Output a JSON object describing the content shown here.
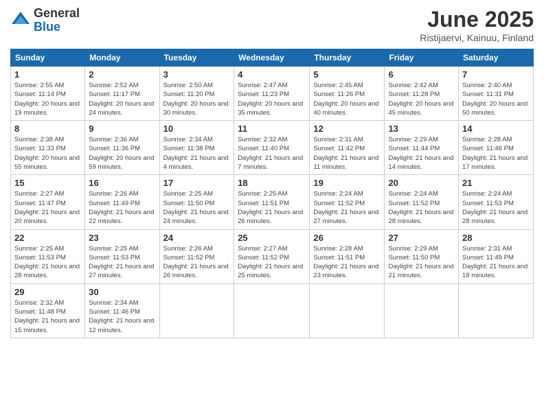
{
  "header": {
    "logo_general": "General",
    "logo_blue": "Blue",
    "title": "June 2025",
    "subtitle": "Ristijaervi, Kainuu, Finland"
  },
  "calendar": {
    "headers": [
      "Sunday",
      "Monday",
      "Tuesday",
      "Wednesday",
      "Thursday",
      "Friday",
      "Saturday"
    ],
    "weeks": [
      [
        {
          "day": "1",
          "sunrise": "Sunrise: 2:55 AM",
          "sunset": "Sunset: 11:14 PM",
          "daylight": "Daylight: 20 hours and 19 minutes."
        },
        {
          "day": "2",
          "sunrise": "Sunrise: 2:52 AM",
          "sunset": "Sunset: 11:17 PM",
          "daylight": "Daylight: 20 hours and 24 minutes."
        },
        {
          "day": "3",
          "sunrise": "Sunrise: 2:50 AM",
          "sunset": "Sunset: 11:20 PM",
          "daylight": "Daylight: 20 hours and 30 minutes."
        },
        {
          "day": "4",
          "sunrise": "Sunrise: 2:47 AM",
          "sunset": "Sunset: 11:23 PM",
          "daylight": "Daylight: 20 hours and 35 minutes."
        },
        {
          "day": "5",
          "sunrise": "Sunrise: 2:45 AM",
          "sunset": "Sunset: 11:26 PM",
          "daylight": "Daylight: 20 hours and 40 minutes."
        },
        {
          "day": "6",
          "sunrise": "Sunrise: 2:42 AM",
          "sunset": "Sunset: 11:28 PM",
          "daylight": "Daylight: 20 hours and 45 minutes."
        },
        {
          "day": "7",
          "sunrise": "Sunrise: 2:40 AM",
          "sunset": "Sunset: 11:31 PM",
          "daylight": "Daylight: 20 hours and 50 minutes."
        }
      ],
      [
        {
          "day": "8",
          "sunrise": "Sunrise: 2:38 AM",
          "sunset": "Sunset: 11:33 PM",
          "daylight": "Daylight: 20 hours and 55 minutes."
        },
        {
          "day": "9",
          "sunrise": "Sunrise: 2:36 AM",
          "sunset": "Sunset: 11:36 PM",
          "daylight": "Daylight: 20 hours and 59 minutes."
        },
        {
          "day": "10",
          "sunrise": "Sunrise: 2:34 AM",
          "sunset": "Sunset: 11:38 PM",
          "daylight": "Daylight: 21 hours and 4 minutes."
        },
        {
          "day": "11",
          "sunrise": "Sunrise: 2:32 AM",
          "sunset": "Sunset: 11:40 PM",
          "daylight": "Daylight: 21 hours and 7 minutes."
        },
        {
          "day": "12",
          "sunrise": "Sunrise: 2:31 AM",
          "sunset": "Sunset: 11:42 PM",
          "daylight": "Daylight: 21 hours and 11 minutes."
        },
        {
          "day": "13",
          "sunrise": "Sunrise: 2:29 AM",
          "sunset": "Sunset: 11:44 PM",
          "daylight": "Daylight: 21 hours and 14 minutes."
        },
        {
          "day": "14",
          "sunrise": "Sunrise: 2:28 AM",
          "sunset": "Sunset: 11:46 PM",
          "daylight": "Daylight: 21 hours and 17 minutes."
        }
      ],
      [
        {
          "day": "15",
          "sunrise": "Sunrise: 2:27 AM",
          "sunset": "Sunset: 11:47 PM",
          "daylight": "Daylight: 21 hours and 20 minutes."
        },
        {
          "day": "16",
          "sunrise": "Sunrise: 2:26 AM",
          "sunset": "Sunset: 11:49 PM",
          "daylight": "Daylight: 21 hours and 22 minutes."
        },
        {
          "day": "17",
          "sunrise": "Sunrise: 2:25 AM",
          "sunset": "Sunset: 11:50 PM",
          "daylight": "Daylight: 21 hours and 24 minutes."
        },
        {
          "day": "18",
          "sunrise": "Sunrise: 2:25 AM",
          "sunset": "Sunset: 11:51 PM",
          "daylight": "Daylight: 21 hours and 26 minutes."
        },
        {
          "day": "19",
          "sunrise": "Sunrise: 2:24 AM",
          "sunset": "Sunset: 11:52 PM",
          "daylight": "Daylight: 21 hours and 27 minutes."
        },
        {
          "day": "20",
          "sunrise": "Sunrise: 2:24 AM",
          "sunset": "Sunset: 11:52 PM",
          "daylight": "Daylight: 21 hours and 28 minutes."
        },
        {
          "day": "21",
          "sunrise": "Sunrise: 2:24 AM",
          "sunset": "Sunset: 11:53 PM",
          "daylight": "Daylight: 21 hours and 28 minutes."
        }
      ],
      [
        {
          "day": "22",
          "sunrise": "Sunrise: 2:25 AM",
          "sunset": "Sunset: 11:53 PM",
          "daylight": "Daylight: 21 hours and 28 minutes."
        },
        {
          "day": "23",
          "sunrise": "Sunrise: 2:25 AM",
          "sunset": "Sunset: 11:53 PM",
          "daylight": "Daylight: 21 hours and 27 minutes."
        },
        {
          "day": "24",
          "sunrise": "Sunrise: 2:26 AM",
          "sunset": "Sunset: 11:52 PM",
          "daylight": "Daylight: 21 hours and 26 minutes."
        },
        {
          "day": "25",
          "sunrise": "Sunrise: 2:27 AM",
          "sunset": "Sunset: 11:52 PM",
          "daylight": "Daylight: 21 hours and 25 minutes."
        },
        {
          "day": "26",
          "sunrise": "Sunrise: 2:28 AM",
          "sunset": "Sunset: 11:51 PM",
          "daylight": "Daylight: 21 hours and 23 minutes."
        },
        {
          "day": "27",
          "sunrise": "Sunrise: 2:29 AM",
          "sunset": "Sunset: 11:50 PM",
          "daylight": "Daylight: 21 hours and 21 minutes."
        },
        {
          "day": "28",
          "sunrise": "Sunrise: 2:31 AM",
          "sunset": "Sunset: 11:49 PM",
          "daylight": "Daylight: 21 hours and 18 minutes."
        }
      ],
      [
        {
          "day": "29",
          "sunrise": "Sunrise: 2:32 AM",
          "sunset": "Sunset: 11:48 PM",
          "daylight": "Daylight: 21 hours and 15 minutes."
        },
        {
          "day": "30",
          "sunrise": "Sunrise: 2:34 AM",
          "sunset": "Sunset: 11:46 PM",
          "daylight": "Daylight: 21 hours and 12 minutes."
        },
        null,
        null,
        null,
        null,
        null
      ]
    ]
  }
}
